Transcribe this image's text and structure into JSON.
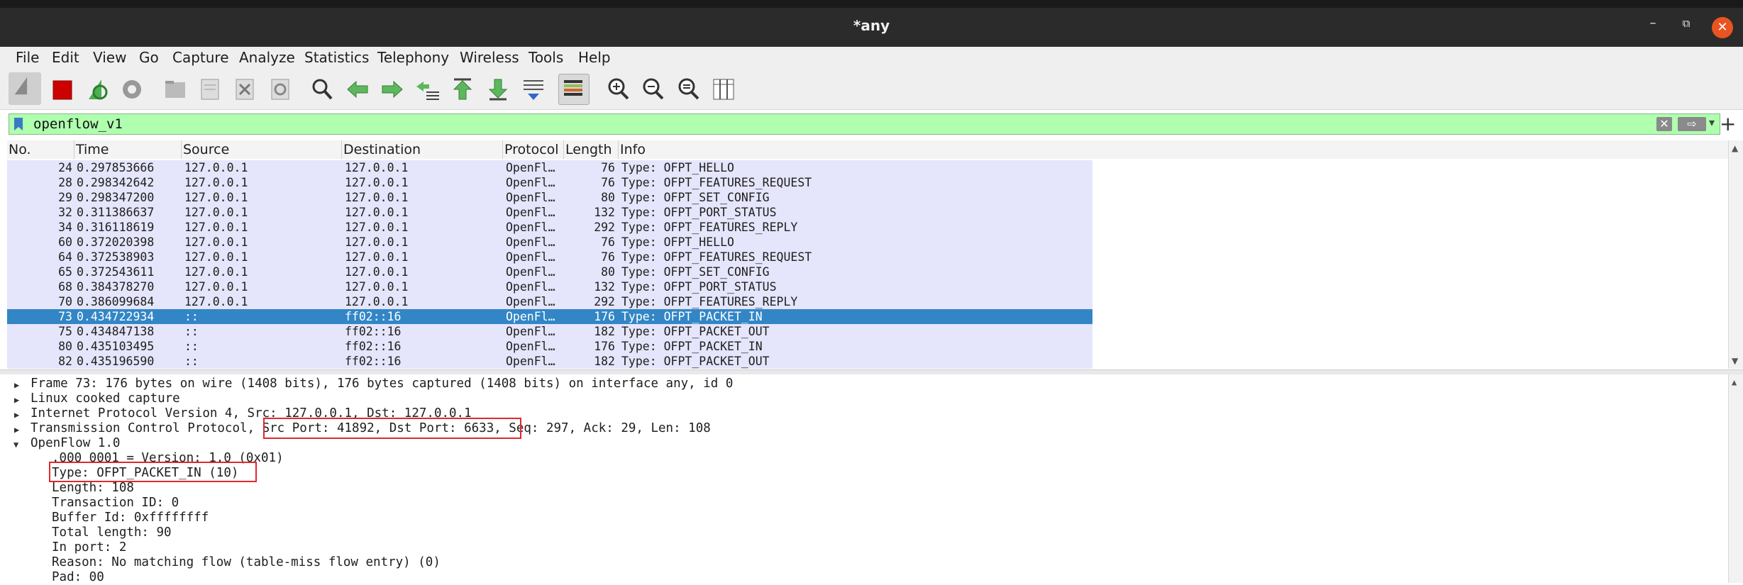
{
  "window": {
    "title": "*any",
    "minimize": "–",
    "maximize": "⧉",
    "close": "✕"
  },
  "menu": {
    "items": [
      "File",
      "Edit",
      "View",
      "Go",
      "Capture",
      "Analyze",
      "Statistics",
      "Telephony",
      "Wireless",
      "Tools",
      "Help"
    ]
  },
  "toolbar": {
    "icons": [
      "shark-fin-start-icon",
      "stop-capture-icon",
      "restart-capture-icon",
      "capture-options-icon",
      "open-file-icon",
      "save-file-icon",
      "close-file-icon",
      "reload-icon",
      "find-packet-icon",
      "go-back-icon",
      "go-forward-icon",
      "go-to-packet-icon",
      "go-first-icon",
      "go-last-icon",
      "autoscroll-icon",
      "colorize-icon",
      "zoom-in-icon",
      "zoom-out-icon",
      "zoom-normal-icon",
      "resize-columns-icon"
    ]
  },
  "filter": {
    "value": "openflow_v1",
    "clear_label": "✕",
    "apply_label": "⇨",
    "dropdown_label": "▾",
    "add_label": "+"
  },
  "packet_list": {
    "columns": [
      "No.",
      "Time",
      "Source",
      "Destination",
      "Protocol",
      "Length",
      "Info"
    ],
    "rows": [
      {
        "no": "24",
        "time": "0.297853666",
        "src": "127.0.0.1",
        "dst": "127.0.0.1",
        "proto": "OpenFl…",
        "len": "76",
        "info": "Type: OFPT_HELLO"
      },
      {
        "no": "28",
        "time": "0.298342642",
        "src": "127.0.0.1",
        "dst": "127.0.0.1",
        "proto": "OpenFl…",
        "len": "76",
        "info": "Type: OFPT_FEATURES_REQUEST"
      },
      {
        "no": "29",
        "time": "0.298347200",
        "src": "127.0.0.1",
        "dst": "127.0.0.1",
        "proto": "OpenFl…",
        "len": "80",
        "info": "Type: OFPT_SET_CONFIG"
      },
      {
        "no": "32",
        "time": "0.311386637",
        "src": "127.0.0.1",
        "dst": "127.0.0.1",
        "proto": "OpenFl…",
        "len": "132",
        "info": "Type: OFPT_PORT_STATUS"
      },
      {
        "no": "34",
        "time": "0.316118619",
        "src": "127.0.0.1",
        "dst": "127.0.0.1",
        "proto": "OpenFl…",
        "len": "292",
        "info": "Type: OFPT_FEATURES_REPLY"
      },
      {
        "no": "60",
        "time": "0.372020398",
        "src": "127.0.0.1",
        "dst": "127.0.0.1",
        "proto": "OpenFl…",
        "len": "76",
        "info": "Type: OFPT_HELLO"
      },
      {
        "no": "64",
        "time": "0.372538903",
        "src": "127.0.0.1",
        "dst": "127.0.0.1",
        "proto": "OpenFl…",
        "len": "76",
        "info": "Type: OFPT_FEATURES_REQUEST"
      },
      {
        "no": "65",
        "time": "0.372543611",
        "src": "127.0.0.1",
        "dst": "127.0.0.1",
        "proto": "OpenFl…",
        "len": "80",
        "info": "Type: OFPT_SET_CONFIG"
      },
      {
        "no": "68",
        "time": "0.384378270",
        "src": "127.0.0.1",
        "dst": "127.0.0.1",
        "proto": "OpenFl…",
        "len": "132",
        "info": "Type: OFPT_PORT_STATUS"
      },
      {
        "no": "70",
        "time": "0.386099684",
        "src": "127.0.0.1",
        "dst": "127.0.0.1",
        "proto": "OpenFl…",
        "len": "292",
        "info": "Type: OFPT_FEATURES_REPLY"
      },
      {
        "no": "73",
        "time": "0.434722934",
        "src": "::",
        "dst": "ff02::16",
        "proto": "OpenFl…",
        "len": "176",
        "info": "Type: OFPT_PACKET_IN",
        "selected": true
      },
      {
        "no": "75",
        "time": "0.434847138",
        "src": "::",
        "dst": "ff02::16",
        "proto": "OpenFl…",
        "len": "182",
        "info": "Type: OFPT_PACKET_OUT"
      },
      {
        "no": "80",
        "time": "0.435103495",
        "src": "::",
        "dst": "ff02::16",
        "proto": "OpenFl…",
        "len": "176",
        "info": "Type: OFPT_PACKET_IN"
      },
      {
        "no": "82",
        "time": "0.435196590",
        "src": "::",
        "dst": "ff02::16",
        "proto": "OpenFl…",
        "len": "182",
        "info": "Type: OFPT_PACKET_OUT"
      }
    ]
  },
  "details": {
    "frame": "Frame 73: 176 bytes on wire (1408 bits), 176 bytes captured (1408 bits) on interface any, id 0",
    "linux": "Linux cooked capture",
    "ipv4": "Internet Protocol Version 4, Src: 127.0.0.1, Dst: 127.0.0.1",
    "tcp": "Transmission Control Protocol, Src Port: 41892, Dst Port: 6633, Seq: 297, Ack: 29, Len: 108",
    "openflow": "OpenFlow 1.0",
    "fields": [
      ".000 0001 = Version: 1.0 (0x01)",
      "Type: OFPT_PACKET_IN (10)",
      "Length: 108",
      "Transaction ID: 0",
      "Buffer Id: 0xffffffff",
      "Total length: 90",
      "In port: 2",
      "Reason: No matching flow (table-miss flow entry) (0)",
      "Pad: 00"
    ]
  },
  "colors": {
    "filter_bg": "#afffaf",
    "row_bg": "#e5e5fb",
    "selected_bg": "#3286c6",
    "highlight_box": "#e0282e"
  }
}
